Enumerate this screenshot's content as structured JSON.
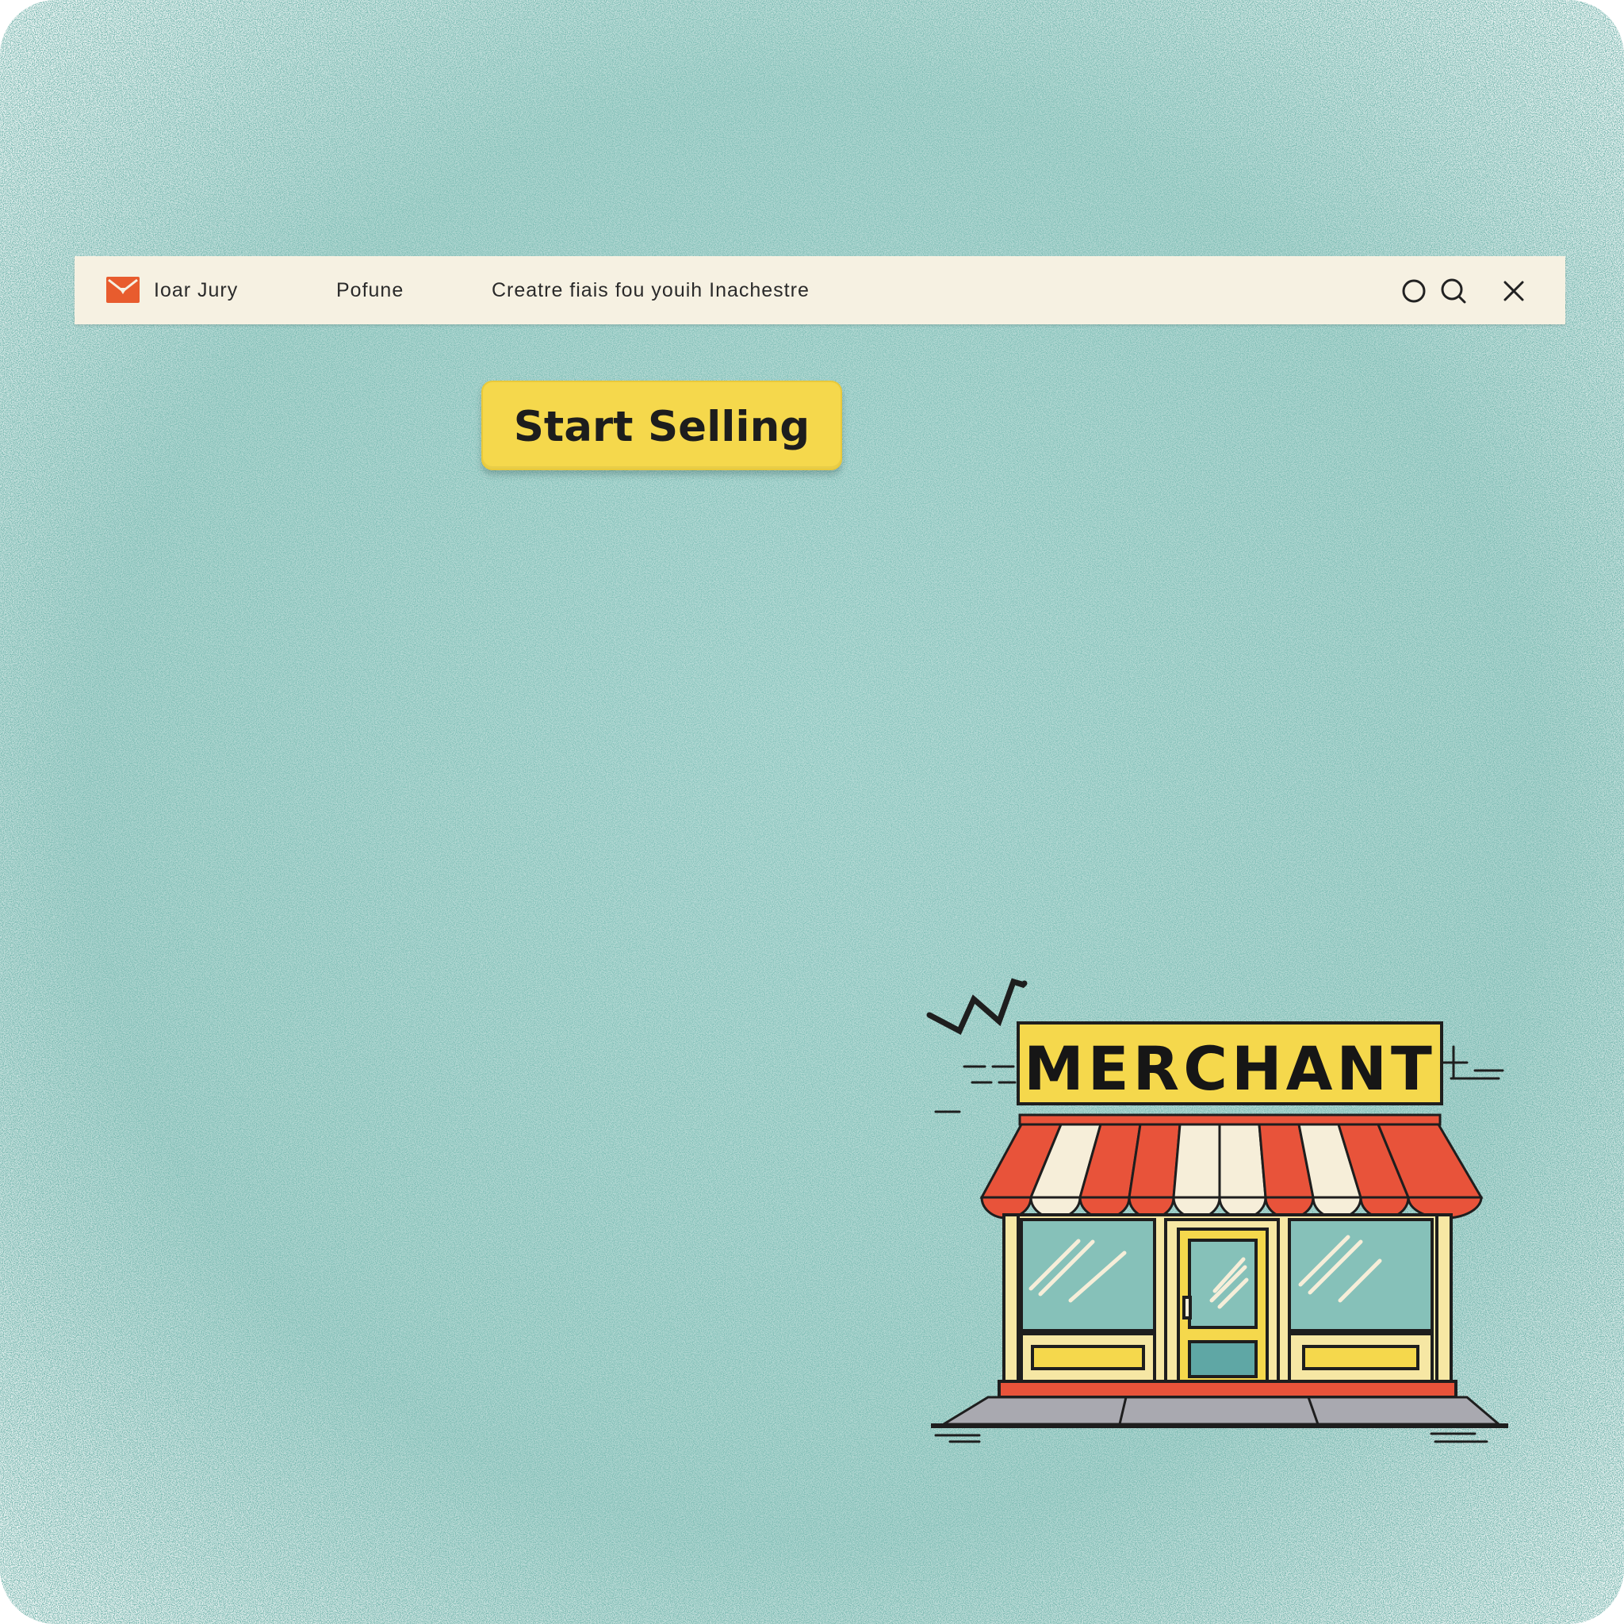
{
  "topbar": {
    "brand": "Ioar Jury",
    "nav_item": "Pofune",
    "tagline": "Creatre fiais fou youih Inachestre",
    "logo_icon": "mail-envelope-icon",
    "icons": [
      "circle-icon",
      "search-icon",
      "close-icon"
    ]
  },
  "cta": {
    "label": "Start Selling"
  },
  "storefront": {
    "sign": "MERCHANT"
  },
  "colors": {
    "background": "#86c1b9",
    "bar": "#f6f1e2",
    "button": "#f5d84c",
    "accent_red": "#e8533a",
    "logo": "#e85c2e"
  }
}
